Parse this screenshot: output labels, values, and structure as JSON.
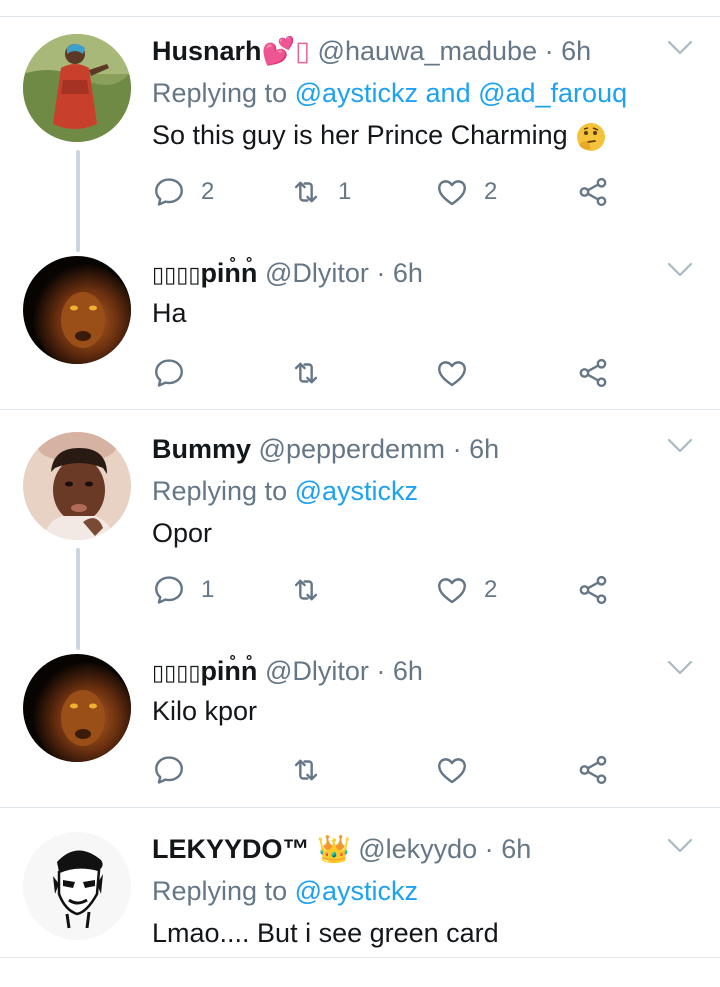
{
  "colors": {
    "text": "#14171a",
    "secondary": "#657786",
    "link": "#1da1f2",
    "divider": "#e1e8ed",
    "thread_line": "#ccd6dd"
  },
  "tweets": [
    {
      "name": "Husnarh",
      "name_suffix": "💕▯",
      "handle": "@hauwa_madube",
      "dot": "·",
      "time": "6h",
      "reply_prefix": "Replying to",
      "reply_to": "@aystickz and @ad_farouq",
      "text": "So this guy is her Prince Charming",
      "text_emoji": "thinking-face-icon",
      "avatar_icon": "woman-in-red-dress-avatar",
      "replies": "2",
      "retweets": "1",
      "likes": "2"
    },
    {
      "name_prefix": "▯▯▯▯",
      "name": "pin̊n̊",
      "handle": "@Dlyitor",
      "dot": "·",
      "time": "6h",
      "text": "Ha",
      "avatar_icon": "lion-avatar",
      "replies": "",
      "retweets": "",
      "likes": ""
    },
    {
      "name": "Bummy",
      "handle": "@pepperdemm",
      "dot": "·",
      "time": "6h",
      "reply_prefix": "Replying to",
      "reply_to": "@aystickz",
      "text": "Opor",
      "avatar_icon": "woman-selfie-avatar",
      "replies": "1",
      "retweets": "",
      "likes": "2"
    },
    {
      "name_prefix": "▯▯▯▯",
      "name": "pin̊n̊",
      "handle": "@Dlyitor",
      "dot": "·",
      "time": "6h",
      "text": "Kilo kpor",
      "avatar_icon": "lion-avatar",
      "replies": "",
      "retweets": "",
      "likes": ""
    },
    {
      "name": "LEKYYDO™",
      "name_suffix": "👑",
      "handle": "@lekyydo",
      "dot": "·",
      "time": "6h",
      "reply_prefix": "Replying to",
      "reply_to": "@aystickz",
      "text": "Lmao.... But i see green card",
      "avatar_icon": "sketch-face-avatar"
    }
  ]
}
